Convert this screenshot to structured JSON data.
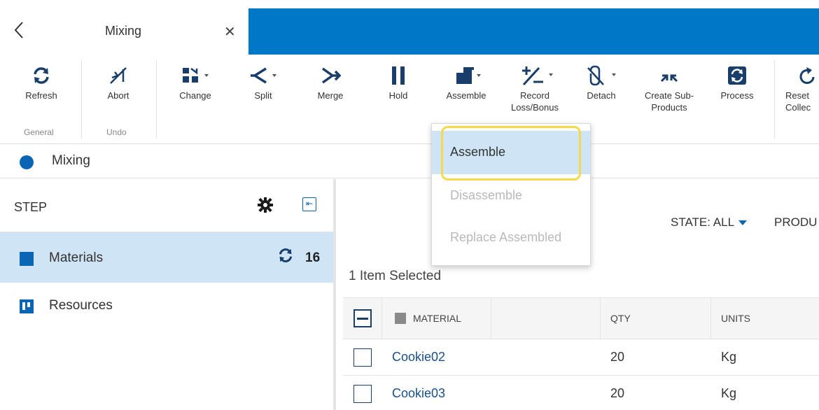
{
  "tab": {
    "title": "Mixing",
    "back_glyph": "‹",
    "close_glyph": "✕"
  },
  "ribbon": {
    "buttons": [
      {
        "label": "Refresh",
        "icon": "refresh-icon"
      },
      {
        "label": "Abort",
        "icon": "abort-icon"
      },
      {
        "label": "Change",
        "icon": "change-icon"
      },
      {
        "label": "Split",
        "icon": "split-icon"
      },
      {
        "label": "Merge",
        "icon": "merge-icon"
      },
      {
        "label": "Hold",
        "icon": "pause-icon"
      },
      {
        "label": "Assemble",
        "icon": "assemble-icon"
      },
      {
        "label": "Record\nLoss/Bonus",
        "label_line1": "Record",
        "label_line2": "Loss/Bonus",
        "icon": "plus-minus-icon"
      },
      {
        "label": "Detach",
        "icon": "detach-icon"
      },
      {
        "label": "Create Sub-\nProducts",
        "label_line1": "Create Sub-",
        "label_line2": "Products",
        "icon": "collapse-arrows-icon"
      },
      {
        "label": "Process",
        "icon": "process-icon"
      },
      {
        "label": "Reset Collec",
        "label_line1": "Reset",
        "label_line2": "Collec",
        "icon": "reset-icon"
      }
    ],
    "groups": {
      "general": "General",
      "undo": "Undo"
    }
  },
  "breadcrumb": {
    "label": "Mixing"
  },
  "left_panel": {
    "title": "STEP",
    "items": [
      {
        "label": "Materials",
        "count": "16",
        "selected": true
      },
      {
        "label": "Resources",
        "selected": false
      }
    ]
  },
  "main": {
    "state_filter": "STATE: ALL",
    "product_filter": "PRODU",
    "selected_count": "1 Item Selected",
    "columns": [
      "MATERIAL",
      "QTY",
      "UNITS"
    ],
    "rows": [
      {
        "material": "Cookie02",
        "qty": "20",
        "units": "Kg"
      },
      {
        "material": "Cookie03",
        "qty": "20",
        "units": "Kg"
      }
    ]
  },
  "dropdown": {
    "items": [
      {
        "label": "Assemble",
        "state": "active"
      },
      {
        "label": "Disassemble",
        "state": "disabled"
      },
      {
        "label": "Replace Assembled",
        "state": "disabled"
      }
    ]
  },
  "colors": {
    "brand_blue": "#0078c8",
    "accent": "#0a66b5",
    "selection": "#cfe4f4",
    "highlight": "#f5d94a"
  }
}
